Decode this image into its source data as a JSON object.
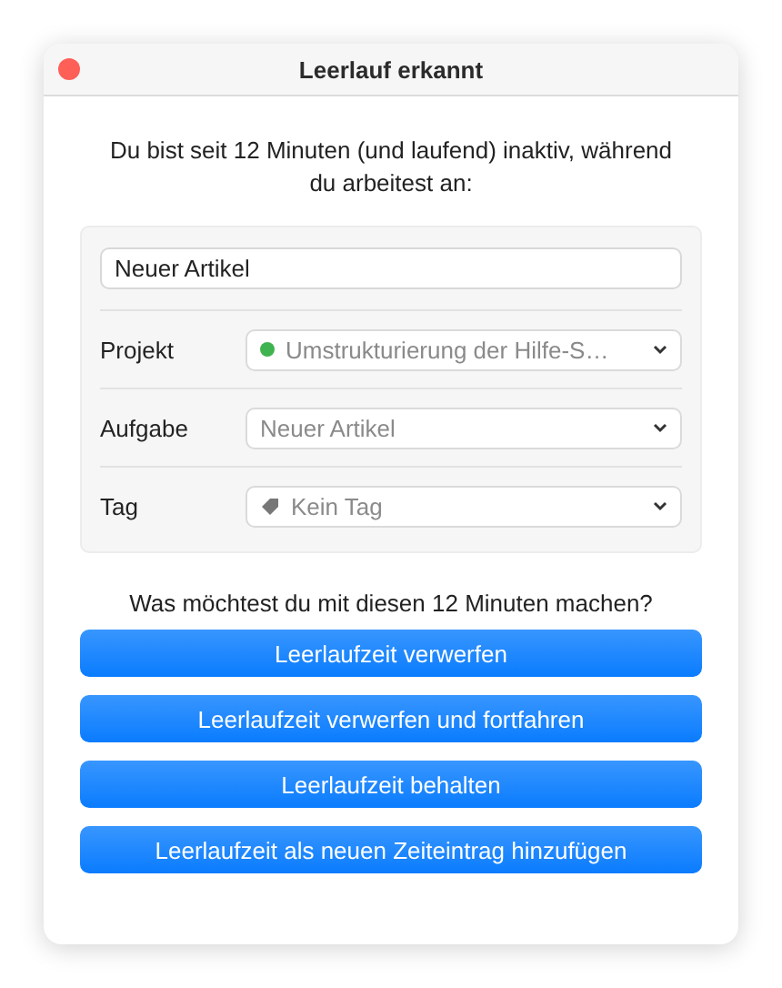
{
  "window": {
    "title": "Leerlauf erkannt"
  },
  "message": "Du bist seit 12 Minuten (und laufend) inaktiv, während du arbeitest an:",
  "entry": {
    "value": "Neuer Artikel"
  },
  "fields": [
    {
      "label": "Projekt",
      "value": "Umstrukturierung der Hilfe-S…",
      "kind": "dot",
      "color": "#3fb34f"
    },
    {
      "label": "Aufgabe",
      "value": "Neuer Artikel",
      "kind": "plain"
    },
    {
      "label": "Tag",
      "value": "Kein Tag",
      "kind": "tag"
    }
  ],
  "question": "Was möchtest du mit diesen 12 Minuten machen?",
  "buttons": [
    "Leerlaufzeit verwerfen",
    "Leerlaufzeit verwerfen und fortfahren",
    "Leerlaufzeit behalten",
    "Leerlaufzeit als neuen Zeiteintrag hinzufügen"
  ]
}
